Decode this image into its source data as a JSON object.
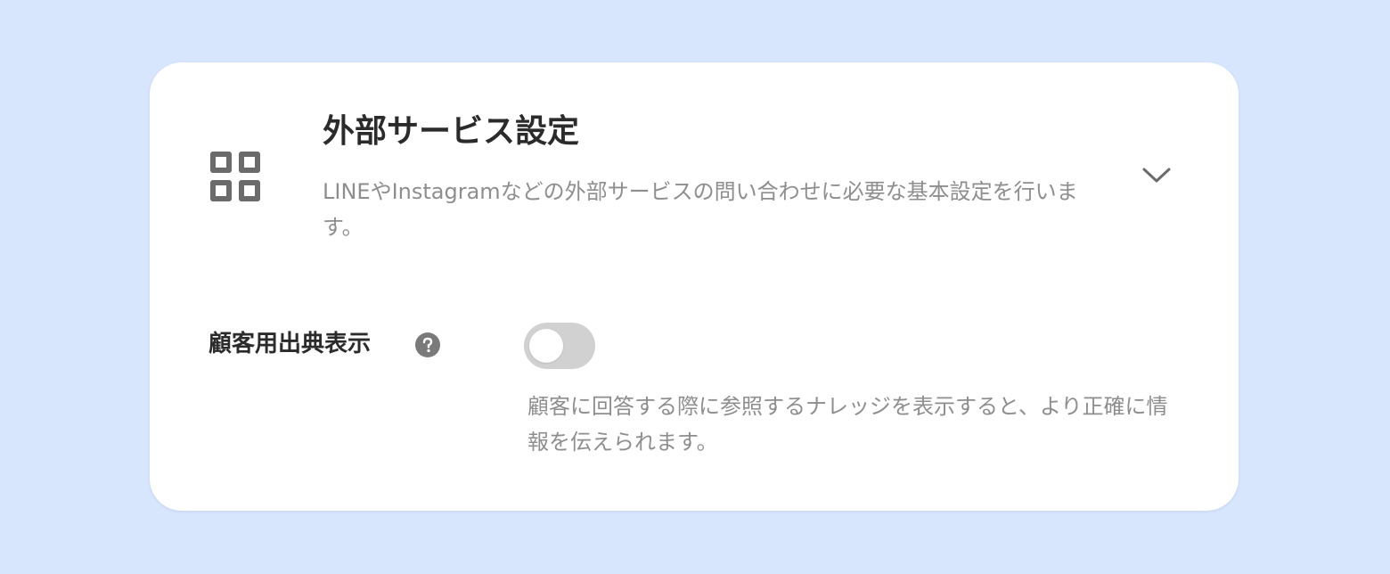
{
  "section": {
    "title": "外部サービス設定",
    "description": "LINEやInstagramなどの外部サービスの問い合わせに必要な基本設定を行います。",
    "icon": "grid-icon",
    "expand_icon": "chevron-down-icon",
    "expanded": false
  },
  "setting": {
    "label": "顧客用出典表示",
    "help_icon": "help-icon",
    "toggle_on": false,
    "description": "顧客に回答する際に参照するナレッジを表示すると、より正確に情報を伝えられます。"
  },
  "colors": {
    "page_background": "#d7e5fd",
    "card_background": "#ffffff",
    "title_text": "#2b2b2b",
    "muted_text": "#8e8e8e",
    "icon": "#6b6b6b",
    "toggle_off": "#d1d1d1"
  }
}
